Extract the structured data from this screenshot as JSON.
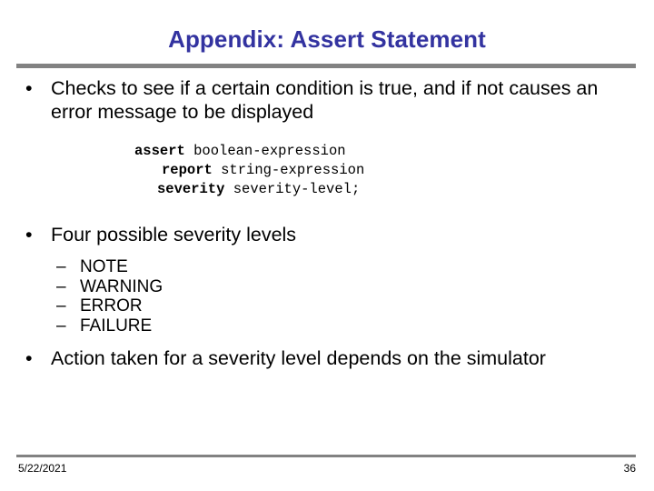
{
  "slide": {
    "title": "Appendix: Assert Statement",
    "title_color": "#3333a0",
    "rule_color": "#828282",
    "background": "#ffffff"
  },
  "content": {
    "bullets": [
      {
        "marker": "•",
        "text": "Checks to see if a certain condition is true, and if not causes an error message to be displayed"
      },
      {
        "marker": "•",
        "text": "Four possible severity levels"
      },
      {
        "marker": "•",
        "text": "Action taken for a severity level depends on the simulator"
      }
    ],
    "code": {
      "lines": [
        {
          "keyword": "assert",
          "operand": " boolean-expression"
        },
        {
          "keyword": "report",
          "operand": " string-expression"
        },
        {
          "keyword": "severity",
          "operand": " severity-level;"
        }
      ]
    },
    "severity_levels": {
      "marker": "–",
      "items": [
        {
          "label": "NOTE"
        },
        {
          "label": "WARNING"
        },
        {
          "label": "ERROR"
        },
        {
          "label": "FAILURE"
        }
      ]
    }
  },
  "footer": {
    "date": "5/22/2021",
    "page_number": "36"
  }
}
